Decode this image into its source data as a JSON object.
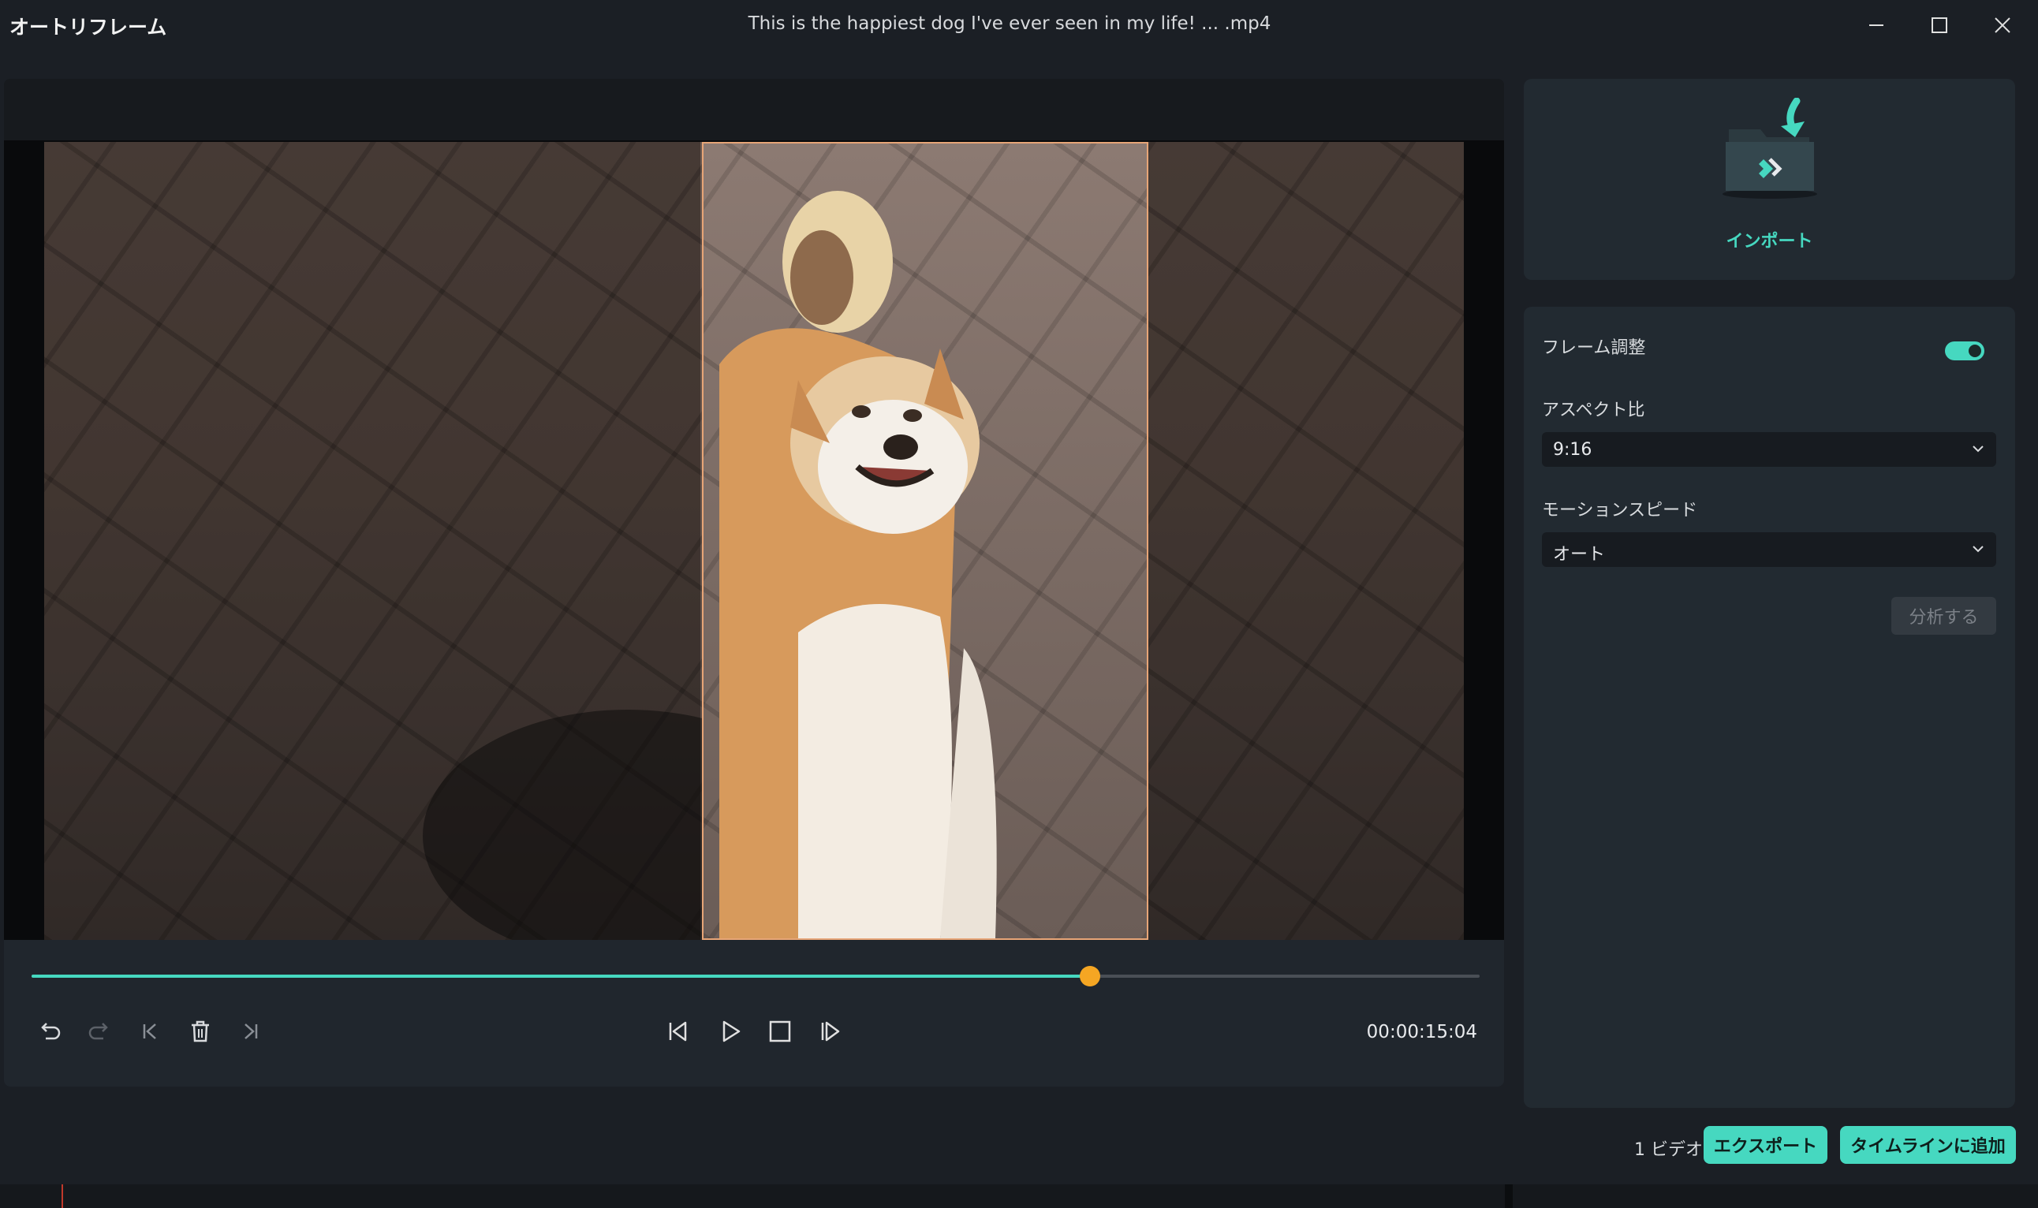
{
  "window": {
    "app_title": "オートリフレーム",
    "file_title": "This is the happiest dog I've ever seen in my life! ... .mp4"
  },
  "player": {
    "progress": 0.731,
    "timecode": "00:00:15:04"
  },
  "import": {
    "label": "インポート"
  },
  "settings": {
    "frame_adjust_label": "フレーム調整",
    "frame_adjust_on": true,
    "aspect_label": "アスペクト比",
    "aspect_value": "9:16",
    "motion_label": "モーションスピード",
    "motion_value": "オート",
    "analyze_label": "分析する"
  },
  "footer": {
    "video_count": "1 ビデオ",
    "export_label": "エクスポート",
    "add_timeline_label": "タイムラインに追加"
  },
  "colors": {
    "accent": "#46d8c0",
    "scrub_knob": "#f5a623",
    "crop_border": "#e7a577"
  }
}
